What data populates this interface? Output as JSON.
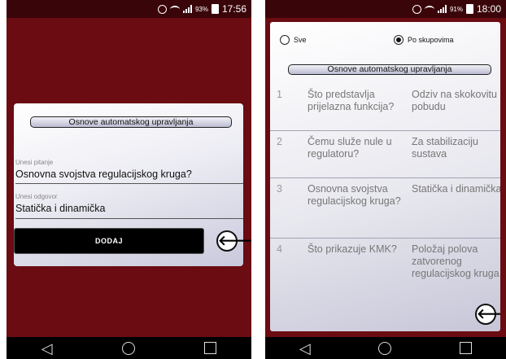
{
  "left_screen": {
    "status": {
      "battery_pct": "93%",
      "time": "17:56"
    },
    "dialog": {
      "title": "Osnove automatskog upravljanja",
      "question_label": "Unesi pitanje",
      "question_value": "Osnovna svojstva regulacijskog kruga?",
      "answer_label": "Unesi odgovor",
      "answer_value": "Statička i dinamička",
      "add_button": "DODAJ",
      "back_glyph": "🡐"
    },
    "nav": {
      "back": "◁"
    }
  },
  "right_screen": {
    "status": {
      "battery_pct": "91%",
      "time": "18:00"
    },
    "filter": {
      "options": [
        {
          "label": "Sve",
          "selected": false
        },
        {
          "label": "Po skupovima",
          "selected": true
        }
      ]
    },
    "title": "Osnove automatskog upravljanja",
    "rows": [
      {
        "num": "1",
        "question": "Što predstavlja prijelazna funkcija?",
        "answer": "Odziv na skokovitu pobudu"
      },
      {
        "num": "2",
        "question": "Čemu služe nule u regulatoru?",
        "answer": "Za stabilizaciju sustava"
      },
      {
        "num": "3",
        "question": "Osnovna svojstva regulacijskog kruga?",
        "answer": "Statička i dinamička"
      },
      {
        "num": "4",
        "question": "Što prikazuje KMK?",
        "answer": "Položaj polova zatvorenog regulacijskog kruga"
      }
    ],
    "back_glyph": "🡐",
    "nav": {
      "back": "◁"
    }
  },
  "colors": {
    "background": "#6a0c12",
    "statusbar": "#3a0509",
    "navbar": "#000000"
  }
}
